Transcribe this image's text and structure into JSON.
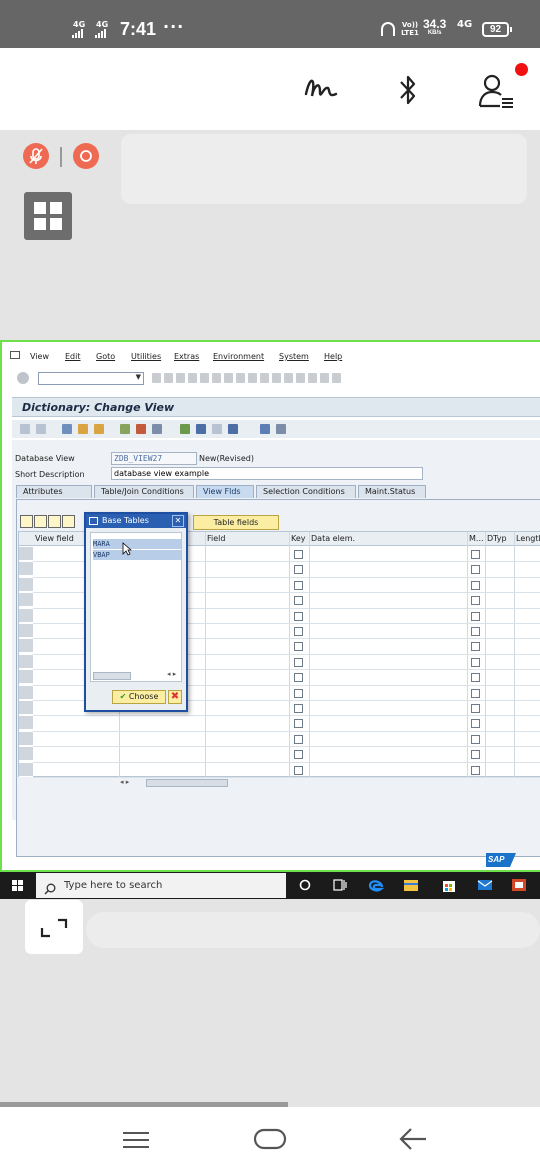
{
  "status_bar": {
    "signal1": "4G",
    "signal2": "4G",
    "time": "7:41",
    "more": "···",
    "volte": "Vo)) LTE1",
    "speed_value": "34.3",
    "speed_unit": "KB/s",
    "signal3": "4G",
    "battery": "92"
  },
  "app_toolbar": {
    "icons": [
      "pen-scribble-icon",
      "bluetooth-icon",
      "user-list-icon"
    ],
    "has_notification": true
  },
  "session_controls": {
    "mic_icon": "mic-off-icon",
    "record_icon": "record-icon"
  },
  "sap": {
    "menu": [
      "View",
      "Edit",
      "Goto",
      "Utilities",
      "Extras",
      "Environment",
      "System",
      "Help"
    ],
    "title": "Dictionary: Change View",
    "database_view_label": "Database View",
    "database_view_value": "ZDB_VIEW27",
    "status_value": "New(Revised)",
    "short_desc_label": "Short Description",
    "short_desc_value": "database view example",
    "tabs": [
      "Attributes",
      "Table/Join Conditions",
      "View Flds",
      "Selection Conditions",
      "Maint.Status"
    ],
    "active_tab": "View Flds",
    "table_fields_button": "Table fields",
    "columns": {
      "view_field": "View field",
      "field": "Field",
      "key": "Key",
      "data_elem": "Data elem.",
      "m": "M...",
      "dtyp": "DTyp",
      "length": "Length"
    },
    "popup": {
      "title": "Base Tables",
      "items": [
        "MARA",
        "VBAP"
      ],
      "choose_label": "Choose",
      "cancel_icon": "cancel-x-icon"
    },
    "logo": "SAP"
  },
  "taskbar": {
    "search_placeholder": "Type here to search",
    "pinned": [
      "cortana-circle-icon",
      "task-view-icon",
      "edge-icon",
      "file-explorer-icon",
      "store-icon",
      "mail-icon",
      "office-icon"
    ]
  },
  "nav": {
    "buttons": [
      "menu-icon",
      "home-icon",
      "back-icon"
    ]
  }
}
